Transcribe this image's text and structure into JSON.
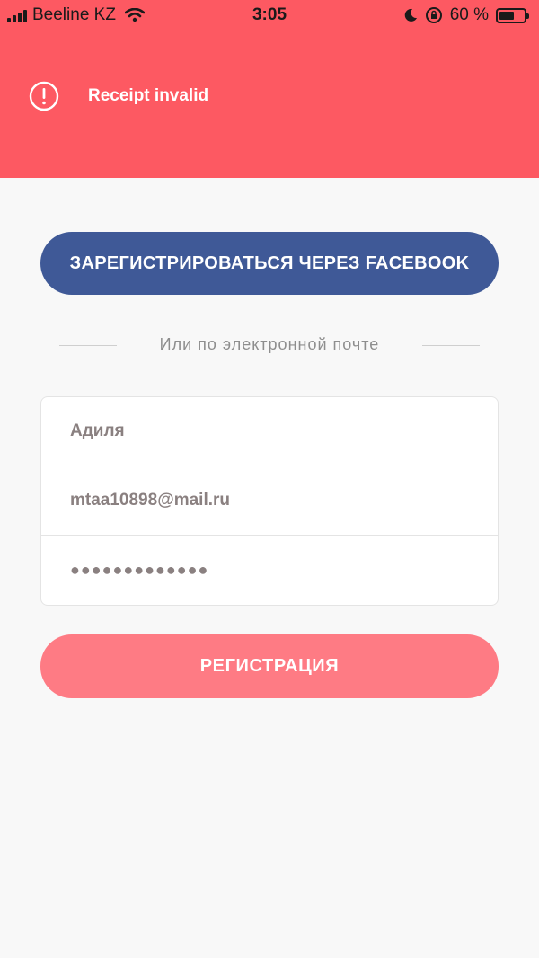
{
  "status_bar": {
    "carrier": "Beeline KZ",
    "time": "3:05",
    "battery_percent": "60 %",
    "battery_level": 0.6
  },
  "alert": {
    "icon": "alert-circle-icon",
    "message": "Receipt invalid",
    "background": "#fd5962"
  },
  "facebook_button": {
    "label": "ЗАРЕГИСТРИРОВАТЬСЯ ЧЕРЕЗ FACEBOOK",
    "color": "#3f5997"
  },
  "divider": {
    "text": "Или по электронной почте"
  },
  "form": {
    "name_value": "Адиля",
    "email_value": "mtaa10898@mail.ru",
    "password_value": "●●●●●●●●●●●●●"
  },
  "register_button": {
    "label": "РЕГИСТРАЦИЯ",
    "color": "#fe7b84"
  }
}
